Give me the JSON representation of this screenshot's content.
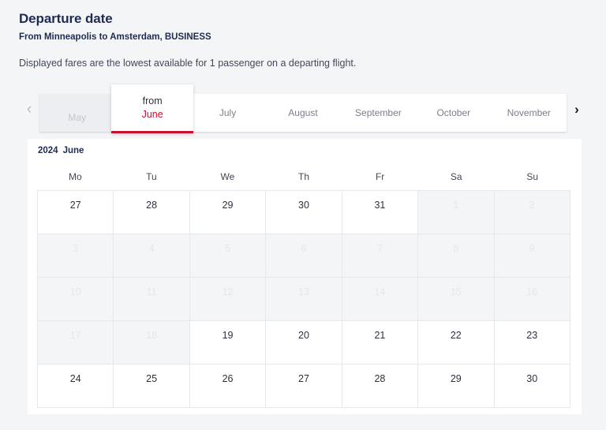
{
  "header": {
    "title": "Departure date",
    "subtitle": "From Minneapolis to Amsterdam, BUSINESS",
    "note": "Displayed fares are the lowest available for 1 passenger on a departing flight."
  },
  "month_selector": {
    "prev_icon": "chevron-left-icon",
    "next_icon": "chevron-right-icon",
    "active": {
      "from_label": "from",
      "month_label": "June",
      "accent_color": "#c8102e"
    },
    "tabs": [
      {
        "dash": "-",
        "label": "May",
        "state": "disabled"
      },
      {
        "label": "June",
        "state": "active"
      },
      {
        "label": "July",
        "state": "enabled"
      },
      {
        "label": "August",
        "state": "enabled"
      },
      {
        "label": "September",
        "state": "enabled"
      },
      {
        "label": "October",
        "state": "enabled"
      },
      {
        "label": "November",
        "state": "enabled"
      }
    ]
  },
  "calendar": {
    "year": "2024",
    "month": "June",
    "weekdays": [
      "Mo",
      "Tu",
      "We",
      "Th",
      "Fr",
      "Sa",
      "Su"
    ],
    "weeks": [
      [
        {
          "day": "27",
          "state": "enabled"
        },
        {
          "day": "28",
          "state": "enabled"
        },
        {
          "day": "29",
          "state": "enabled"
        },
        {
          "day": "30",
          "state": "enabled"
        },
        {
          "day": "31",
          "state": "enabled"
        },
        {
          "day": "1",
          "state": "disabled"
        },
        {
          "day": "2",
          "state": "disabled"
        }
      ],
      [
        {
          "day": "3",
          "state": "disabled"
        },
        {
          "day": "4",
          "state": "disabled"
        },
        {
          "day": "5",
          "state": "disabled"
        },
        {
          "day": "6",
          "state": "disabled"
        },
        {
          "day": "7",
          "state": "disabled"
        },
        {
          "day": "8",
          "state": "disabled"
        },
        {
          "day": "9",
          "state": "disabled"
        }
      ],
      [
        {
          "day": "10",
          "state": "disabled"
        },
        {
          "day": "11",
          "state": "disabled"
        },
        {
          "day": "12",
          "state": "disabled"
        },
        {
          "day": "13",
          "state": "disabled"
        },
        {
          "day": "14",
          "state": "disabled"
        },
        {
          "day": "15",
          "state": "disabled"
        },
        {
          "day": "16",
          "state": "disabled"
        }
      ],
      [
        {
          "day": "17",
          "state": "disabled"
        },
        {
          "day": "18",
          "state": "disabled"
        },
        {
          "day": "19",
          "state": "enabled"
        },
        {
          "day": "20",
          "state": "enabled"
        },
        {
          "day": "21",
          "state": "enabled"
        },
        {
          "day": "22",
          "state": "enabled"
        },
        {
          "day": "23",
          "state": "enabled"
        }
      ],
      [
        {
          "day": "24",
          "state": "enabled"
        },
        {
          "day": "25",
          "state": "enabled"
        },
        {
          "day": "26",
          "state": "enabled"
        },
        {
          "day": "27",
          "state": "enabled"
        },
        {
          "day": "28",
          "state": "enabled"
        },
        {
          "day": "29",
          "state": "enabled"
        },
        {
          "day": "30",
          "state": "enabled"
        }
      ]
    ]
  }
}
